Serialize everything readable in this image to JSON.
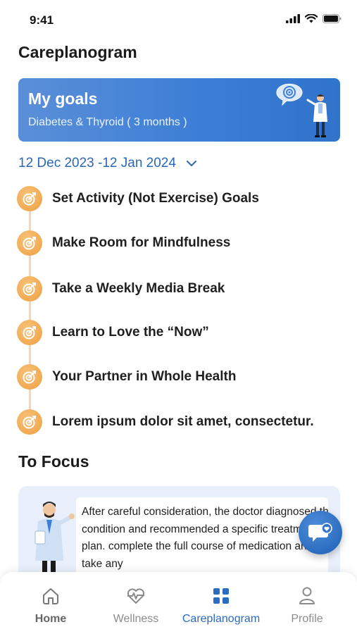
{
  "status_bar": {
    "time": "9:41"
  },
  "header": {
    "title": "Careplanogram"
  },
  "goals_card": {
    "title": "My goals",
    "subtitle": "Diabetes & Thyroid ( 3 months )"
  },
  "date_range": {
    "label": "12 Dec 2023 -12 Jan 2024"
  },
  "goals": [
    {
      "label": "Set Activity (Not Exercise) Goals"
    },
    {
      "label": "Make Room for Mindfulness"
    },
    {
      "label": "Take a Weekly Media Break"
    },
    {
      "label": "Learn to Love the “Now”"
    },
    {
      "label": "Your Partner in Whole Health"
    },
    {
      "label": "Lorem ipsum dolor sit amet, consectetur."
    }
  ],
  "focus": {
    "title": "To Focus",
    "text": "After careful consideration, the doctor diagnosed the condition and recommended a specific treatment plan. complete the full course of medication and  take any"
  },
  "nav": {
    "items": [
      {
        "label": "Home",
        "icon": "home-icon"
      },
      {
        "label": "Wellness",
        "icon": "heartbeat-icon"
      },
      {
        "label": "Careplanogram",
        "icon": "grid-icon"
      },
      {
        "label": "Profile",
        "icon": "user-icon"
      }
    ],
    "active": "Careplanogram"
  },
  "colors": {
    "accent": "#2b6bc0",
    "goal_icon": "#f0a445",
    "card_blue": "#3d7fd6",
    "focus_bg": "#e9f0fb"
  }
}
